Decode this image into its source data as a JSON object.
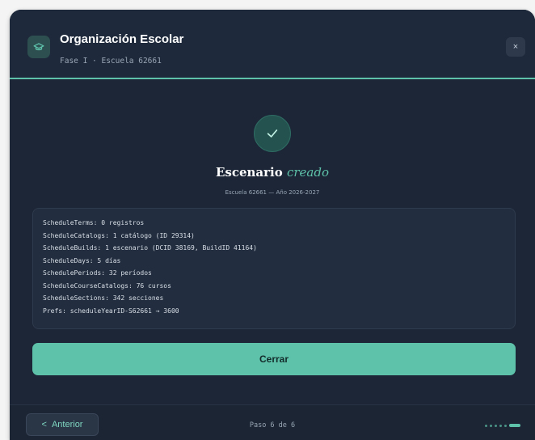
{
  "header": {
    "title": "Organización Escolar",
    "subtitle": "Fase I · Escuela 62661",
    "close_label": "×",
    "logo_icon": "graduation-cap-icon"
  },
  "result": {
    "check_icon": "checkmark-icon",
    "heading_main": "Escenario ",
    "heading_accent": "creado",
    "caption": "Escuela 62661 — Año 2026-2027",
    "log_lines": [
      "ScheduleTerms: 0 registros",
      "ScheduleCatalogs: 1 catálogo (ID 29314)",
      "ScheduleBuilds: 1 escenario (DCID 38169, BuildID 41164)",
      "ScheduleDays: 5 días",
      "SchedulePeriods: 32 períodos",
      "ScheduleCourseCatalogs: 76 cursos",
      "ScheduleSections: 342 secciones",
      "Prefs: scheduleYearID-S62661 → 3600"
    ]
  },
  "actions": {
    "close_button": "Cerrar"
  },
  "footer": {
    "back_chevron": "<",
    "back_label": "Anterior",
    "step_label": "Paso 6 de 6",
    "total_steps": 6,
    "current_step": 6
  },
  "colors": {
    "accent": "#5ec2aa",
    "panel": "#1c2636"
  }
}
